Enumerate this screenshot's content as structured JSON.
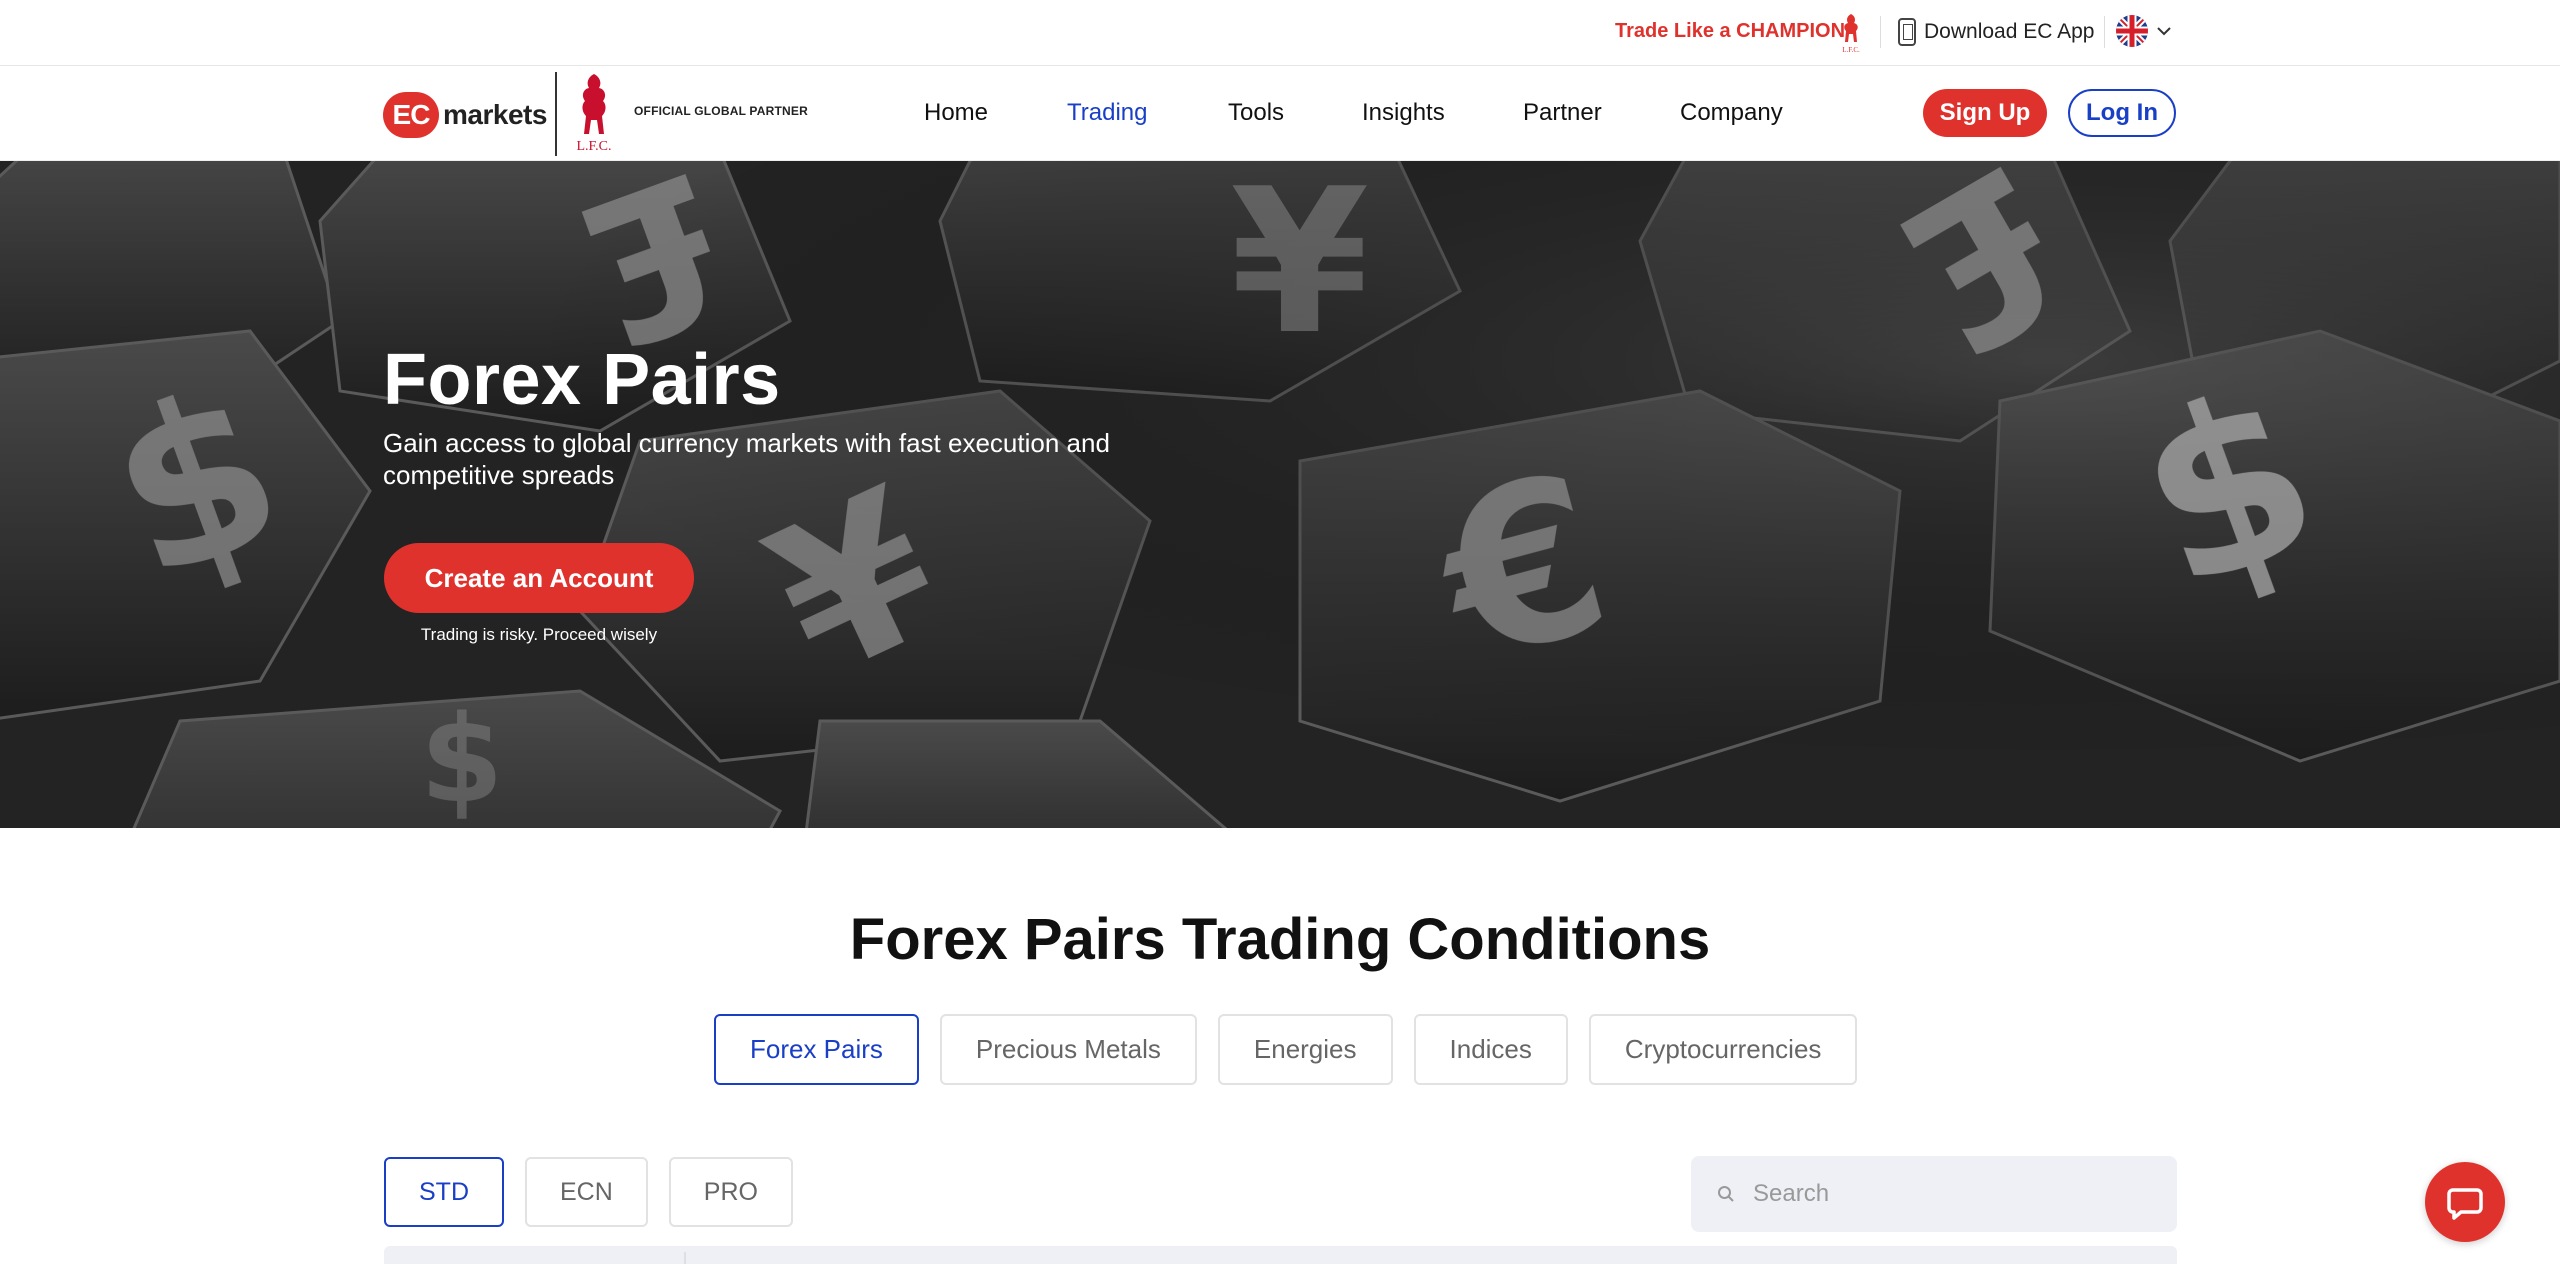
{
  "topbar": {
    "promo": "Trade Like a CHAMPION",
    "download": "Download EC App",
    "language_flag": "uk-flag-icon"
  },
  "brand": {
    "logo_mark": "EC",
    "logo_word": "markets",
    "partner": "OFFICIAL GLOBAL PARTNER"
  },
  "nav": {
    "items": [
      {
        "label": "Home"
      },
      {
        "label": "Trading"
      },
      {
        "label": "Tools"
      },
      {
        "label": "Insights"
      },
      {
        "label": "Partner"
      },
      {
        "label": "Company"
      }
    ],
    "active": "Trading",
    "signup": "Sign Up",
    "login": "Log In"
  },
  "hero": {
    "title": "Forex Pairs",
    "subtitle": "Gain access to global currency markets with fast execution and competitive spreads",
    "cta": "Create an Account",
    "risk": "Trading is risky. Proceed wisely"
  },
  "conditions": {
    "title": "Forex Pairs Trading Conditions",
    "categories": [
      "Forex Pairs",
      "Precious Metals",
      "Energies",
      "Indices",
      "Cryptocurrencies"
    ],
    "active_category": "Forex Pairs",
    "account_types": [
      "STD",
      "ECN",
      "PRO"
    ],
    "active_account": "STD",
    "search_placeholder": "Search"
  },
  "colors": {
    "brand_red": "#e0322d",
    "accent_blue": "#1a3fc7"
  }
}
